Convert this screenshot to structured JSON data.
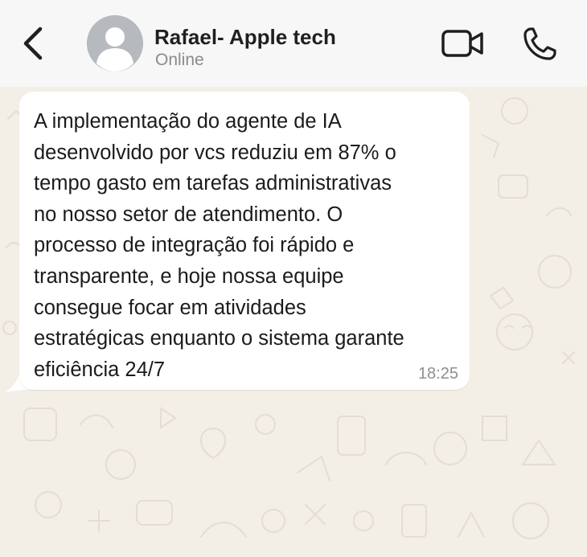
{
  "header": {
    "contact_name": "Rafael- Apple tech",
    "status": "Online",
    "back_icon": "chevron-left-icon",
    "video_icon": "video-camera-icon",
    "call_icon": "phone-icon",
    "avatar_icon": "default-user-avatar"
  },
  "message": {
    "lines": [
      "A implementação do agente de IA",
      "desenvolvido por vcs reduziu em 87% o",
      "tempo gasto em tarefas administrativas",
      "no nosso setor de atendimento. O",
      "processo de integração foi rápido e",
      "transparente, e hoje nossa equipe",
      "consegue focar em atividades",
      "estratégicas enquanto o sistema garante",
      "eficiência 24/7"
    ],
    "time": "18:25"
  },
  "colors": {
    "header_bg": "#f7f7f7",
    "chat_bg": "#f3efe7",
    "bubble_bg": "#ffffff",
    "icon_color": "#1f1f1f",
    "status_color": "#8a8a8a"
  }
}
